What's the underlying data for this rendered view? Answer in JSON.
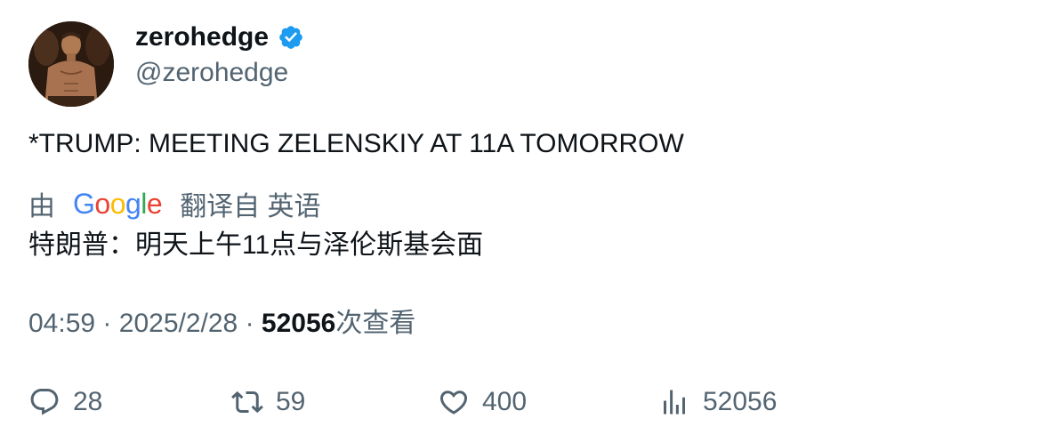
{
  "author": {
    "display_name": "zerohedge",
    "handle": "@zerohedge",
    "verified_icon": "verified-badge-icon",
    "verified_color": "#1d9bf0"
  },
  "tweet": {
    "text": "*TRUMP: MEETING ZELENSKIY AT 11A TOMORROW"
  },
  "translation": {
    "prefix": "由",
    "provider": "Google",
    "suffix": "翻译自 英语",
    "text": "特朗普：明天上午11点与泽伦斯基会面"
  },
  "meta": {
    "time": "04:59",
    "separator": "·",
    "date": "2025/2/28",
    "views_count": "52056",
    "views_label": "次查看"
  },
  "actions": {
    "reply_count": "28",
    "retweet_count": "59",
    "like_count": "400",
    "views_count": "52056"
  },
  "colors": {
    "text_primary": "#0f1419",
    "text_secondary": "#536471",
    "google_blue": "#4285F4",
    "google_red": "#EA4335",
    "google_yellow": "#FBBC05",
    "google_green": "#34A853"
  }
}
